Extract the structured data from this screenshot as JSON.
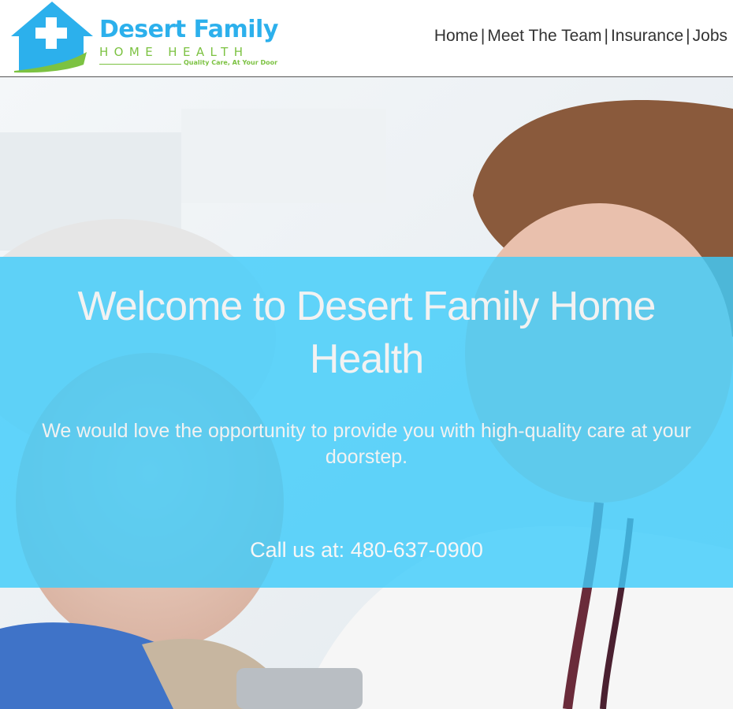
{
  "logo": {
    "title": "Desert Family",
    "subtitle": "HOME HEALTH",
    "tagline": "Quality Care, At Your Door",
    "icon": "house-cross-icon",
    "colors": {
      "blue": "#2cb0ec",
      "green": "#7cc242"
    }
  },
  "nav": {
    "items": [
      {
        "label": "Home"
      },
      {
        "label": "Meet The Team"
      },
      {
        "label": "Insurance"
      },
      {
        "label": "Jobs"
      }
    ],
    "separator": "|"
  },
  "hero": {
    "title": "Welcome to Desert Family Home Health",
    "subtitle": "We would love the opportunity to provide you with high-quality care at your doorstep.",
    "phone_prefix": "Call us at:",
    "phone": "480-637-0900",
    "overlay_color": "#40ccfa"
  }
}
